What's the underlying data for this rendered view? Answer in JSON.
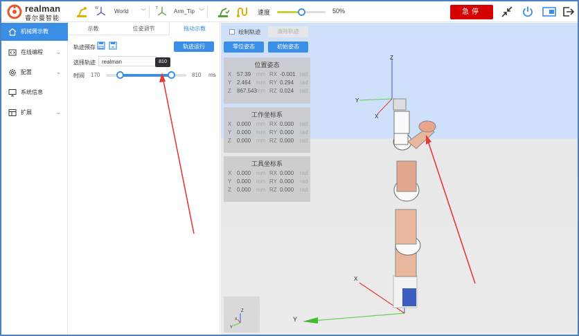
{
  "brand": {
    "name": "realman",
    "subtitle": "睿尔曼智能"
  },
  "topbar": {
    "frame_select": "World",
    "tool_select": "Arm_Tip",
    "speed_label": "速度",
    "speed_value": "50%",
    "speed_fraction": 0.5,
    "estop_label": "急停"
  },
  "sidebar": {
    "items": [
      {
        "label": "机械臂示教",
        "icon": "home-icon",
        "has_chevron": false
      },
      {
        "label": "在线编程",
        "icon": "code-icon",
        "has_chevron": true
      },
      {
        "label": "配置",
        "icon": "gear-icon",
        "has_chevron": true
      },
      {
        "label": "系统信息",
        "icon": "monitor-icon",
        "has_chevron": false
      },
      {
        "label": "扩展",
        "icon": "extension-icon",
        "has_chevron": true
      }
    ]
  },
  "panel": {
    "tabs": [
      "示教",
      "位姿调节",
      "拖动示教"
    ],
    "active_tab": 2,
    "trajectory_save_label": "轨迹预存",
    "run_button": "轨迹运行",
    "select_trajectory_label": "选择轨迹",
    "trajectory_value": "realman",
    "time_label": "时间",
    "time_min": "170",
    "time_max": "810",
    "time_unit": "ms",
    "range_start": 170,
    "range_end": 810,
    "tooltip": "810"
  },
  "viewport": {
    "draw_trajectory_label": "绘制轨迹",
    "clear_trajectory_button": "清除轨迹",
    "zero_pose_button": "零位姿态",
    "initial_pose_button": "初始姿态",
    "cards": [
      {
        "title": "位置姿态",
        "rows": [
          {
            "axis": "X",
            "value": "57.39",
            "unit": "mm",
            "raxis": "RX",
            "rvalue": "-0.001",
            "runit": "rad"
          },
          {
            "axis": "Y",
            "value": "2.464",
            "unit": "mm",
            "raxis": "RY",
            "rvalue": "0.294",
            "runit": "rad"
          },
          {
            "axis": "Z",
            "value": "867.543",
            "unit": "mm",
            "raxis": "RZ",
            "rvalue": "0.024",
            "runit": "rad"
          }
        ]
      },
      {
        "title": "工作坐标系",
        "rows": [
          {
            "axis": "X",
            "value": "0.000",
            "unit": "mm",
            "raxis": "RX",
            "rvalue": "0.000",
            "runit": "rad"
          },
          {
            "axis": "Y",
            "value": "0.000",
            "unit": "mm",
            "raxis": "RY",
            "rvalue": "0.000",
            "runit": "rad"
          },
          {
            "axis": "Z",
            "value": "0.000",
            "unit": "mm",
            "raxis": "RZ",
            "rvalue": "0.000",
            "runit": "rad"
          }
        ]
      },
      {
        "title": "工具坐标系",
        "rows": [
          {
            "axis": "X",
            "value": "0.000",
            "unit": "mm",
            "raxis": "RX",
            "rvalue": "0.000",
            "runit": "rad"
          },
          {
            "axis": "Y",
            "value": "0.000",
            "unit": "mm",
            "raxis": "RY",
            "rvalue": "0.000",
            "runit": "rad"
          },
          {
            "axis": "Z",
            "value": "0.000",
            "unit": "mm",
            "raxis": "RZ",
            "rvalue": "0.000",
            "runit": "rad"
          }
        ]
      }
    ],
    "axis_labels": {
      "x": "X",
      "y": "Y",
      "z": "Z"
    }
  },
  "colors": {
    "accent": "#3a8ee6",
    "estop": "#d60000",
    "sky": "#cfe0fb",
    "annotation": "#e53935"
  }
}
